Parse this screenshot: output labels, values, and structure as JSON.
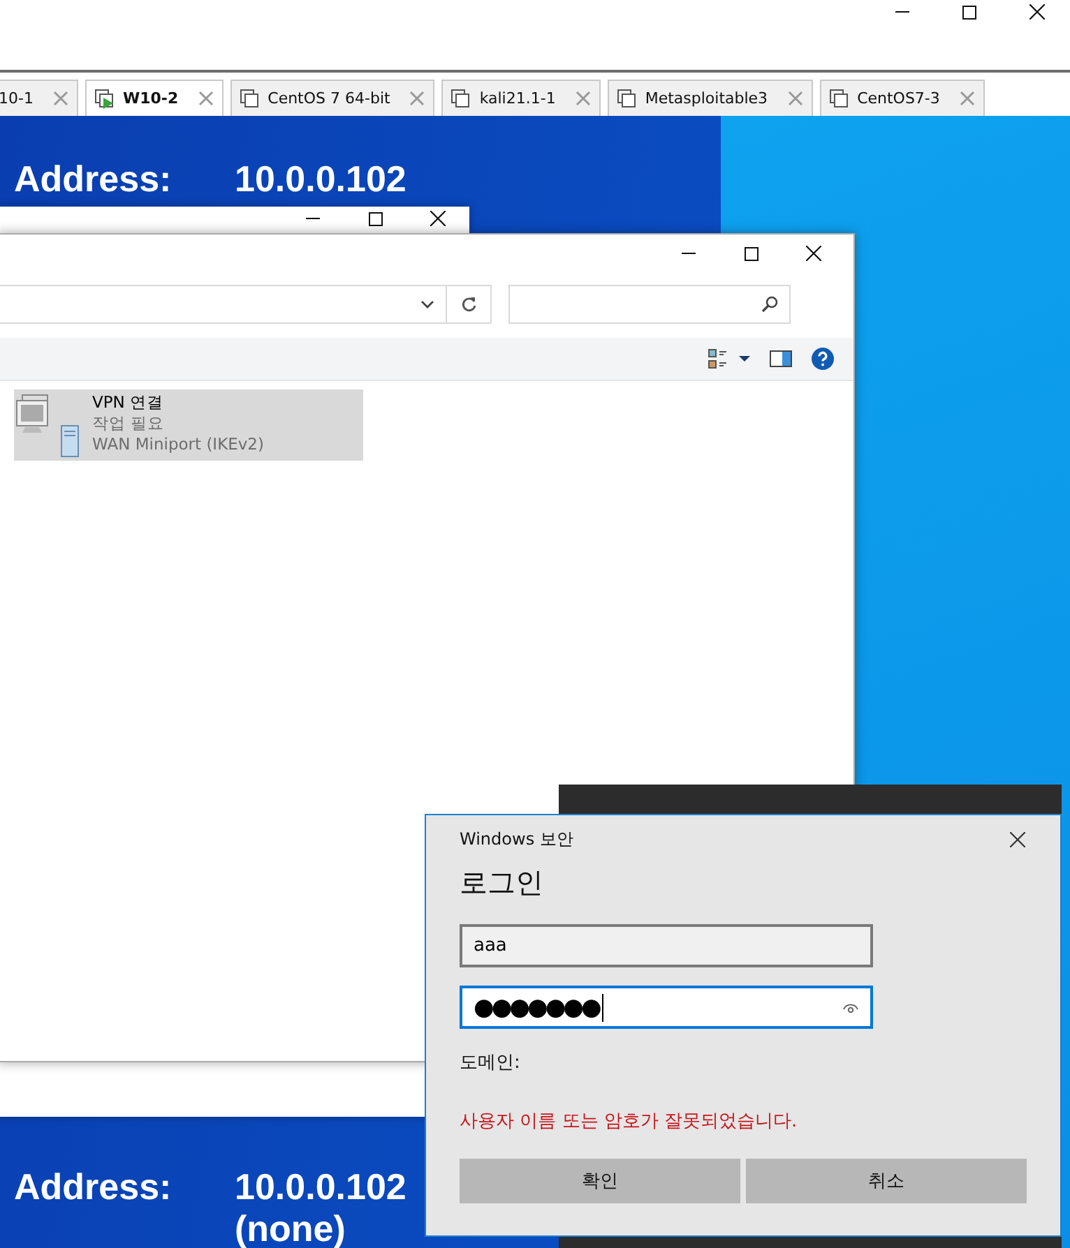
{
  "host_window": {
    "tabs": [
      {
        "label": "10-1",
        "selected": false
      },
      {
        "label": "W10-2",
        "selected": true,
        "running": true
      },
      {
        "label": "CentOS 7 64-bit",
        "selected": false,
        "running": false
      },
      {
        "label": "kali21.1-1",
        "selected": false,
        "running": false
      },
      {
        "label": "Metasploitable3",
        "selected": false,
        "running": false
      },
      {
        "label": "CentOS7-3",
        "selected": false,
        "running": false
      }
    ]
  },
  "desktop": {
    "info_blocks": [
      {
        "label": "Address:",
        "value": "10.0.0.102"
      },
      {
        "label": "Address:",
        "value": "10.0.0.102",
        "extra": "(none)"
      }
    ]
  },
  "explorer": {
    "items": [
      {
        "name": "VPN 연결",
        "status": "작업 필요",
        "device": "WAN Miniport (IKEv2)",
        "selected": true
      }
    ]
  },
  "dialog": {
    "app": "Windows 보안",
    "title": "로그인",
    "fields": [
      {
        "kind": "text",
        "value": "aaa",
        "focused": false
      },
      {
        "kind": "password",
        "value": "●●●●●●●",
        "focused": true
      }
    ],
    "domain_label": "도메인:",
    "error": "사용자 이름 또는 암호가 잘못되었습니다.",
    "buttons": [
      "확인",
      "취소"
    ]
  }
}
